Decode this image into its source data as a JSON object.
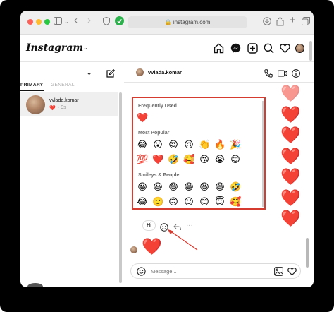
{
  "browser": {
    "url": "instagram.com",
    "icons": [
      "sidebar-icon",
      "back-icon",
      "forward-icon",
      "shield-icon",
      "extension-icon",
      "download-icon",
      "share-icon",
      "new-tab-icon",
      "tabs-overview-icon"
    ],
    "traffic_light_colors": [
      "#fe5f57",
      "#febc2e",
      "#28c840"
    ]
  },
  "instagram": {
    "logo": "Instagram",
    "nav_icons": [
      "home-icon",
      "messenger-icon",
      "new-post-icon",
      "explore-icon",
      "activity-heart-icon",
      "profile-avatar"
    ]
  },
  "inbox": {
    "tabs": [
      {
        "label": "PRIMARY",
        "active": true
      },
      {
        "label": "GENERAL",
        "active": false
      }
    ],
    "conversations": [
      {
        "name": "vvlada.komar",
        "preview_emoji": "❤️",
        "time": "· 9s"
      }
    ]
  },
  "chat": {
    "username": "vvlada.komar",
    "header_icons": [
      "phone-icon",
      "video-icon",
      "info-icon"
    ],
    "sent_hearts": 7,
    "received_message": "Hi",
    "received_reaction": "❤️",
    "composer_placeholder": "Message...",
    "accent_color": "#e0242a"
  },
  "emoji_picker": {
    "sections": [
      {
        "title": "Frequently Used",
        "emojis": [
          "❤️"
        ]
      },
      {
        "title": "Most Popular",
        "emojis": [
          "😂",
          "😮",
          "😍",
          "😢",
          "👏",
          "🔥",
          "🎉",
          "💯",
          "❤️",
          "🤣",
          "🥰",
          "😘",
          "😭",
          "😊"
        ]
      },
      {
        "title": "Smileys & People",
        "emojis": [
          "😀",
          "😃",
          "😄",
          "😁",
          "😆",
          "😅",
          "🤣",
          "😂",
          "🙂",
          "🙃",
          "😉",
          "😊",
          "😇",
          "🥰"
        ]
      }
    ]
  },
  "annotation_color": "#d63b30"
}
